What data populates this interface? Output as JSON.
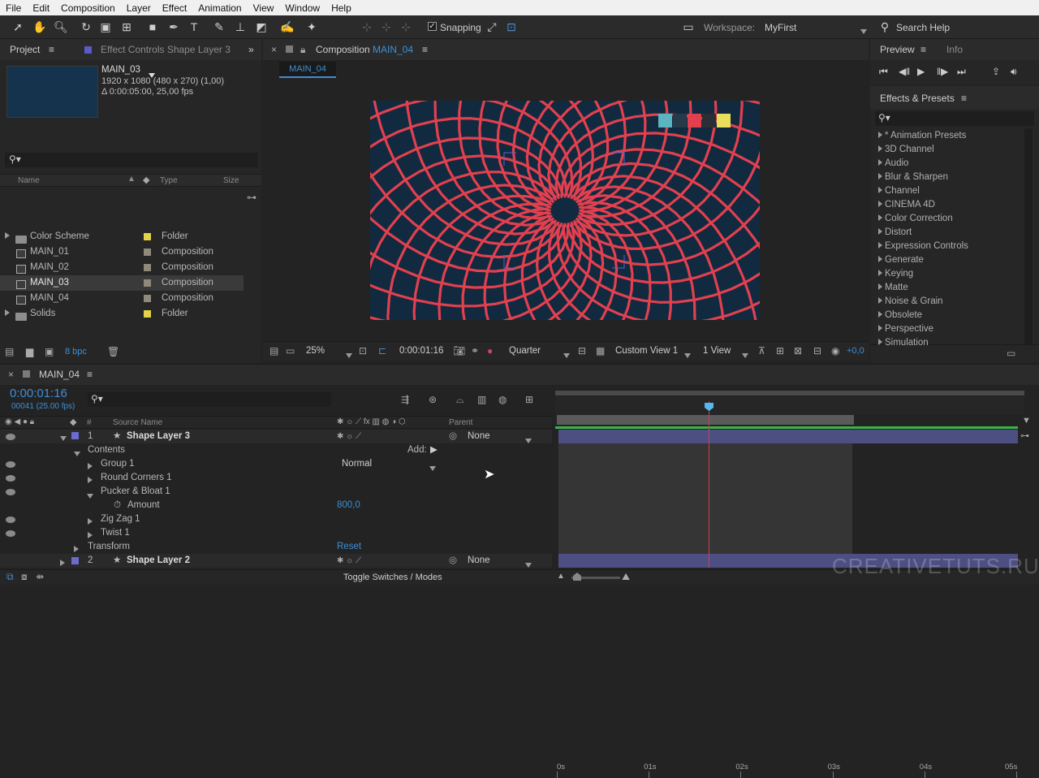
{
  "menu": [
    "File",
    "Edit",
    "Composition",
    "Layer",
    "Effect",
    "Animation",
    "View",
    "Window",
    "Help"
  ],
  "toolbar": {
    "snapping_label": "Snapping",
    "workspace_label": "Workspace:",
    "workspace_value": "MyFirst",
    "search_help": "Search Help"
  },
  "project": {
    "tab_label": "Project",
    "effect_controls_tab": "Effect Controls Shape Layer 3",
    "selected_name": "MAIN_03",
    "selected_info1": "1920 x 1080  (480 x 270) (1,00)",
    "selected_info2": "Δ 0:00:05:00, 25,00 fps",
    "col_name": "Name",
    "col_type": "Type",
    "col_size": "Size",
    "items": [
      {
        "name": "Color Scheme",
        "type": "Folder",
        "color": "#e3d24a",
        "kind": "folder"
      },
      {
        "name": "MAIN_01",
        "type": "Composition",
        "color": "#8f8a7a",
        "kind": "comp"
      },
      {
        "name": "MAIN_02",
        "type": "Composition",
        "color": "#8f8a7a",
        "kind": "comp"
      },
      {
        "name": "MAIN_03",
        "type": "Composition",
        "color": "#8f8a7a",
        "kind": "comp"
      },
      {
        "name": "MAIN_04",
        "type": "Composition",
        "color": "#8f8a7a",
        "kind": "comp"
      },
      {
        "name": "Solids",
        "type": "Folder",
        "color": "#e3d24a",
        "kind": "folder"
      }
    ],
    "bpc": "8 bpc"
  },
  "composition": {
    "tab_prefix": "Composition",
    "tab_name": "MAIN_04",
    "subtab": "MAIN_04",
    "zoom": "25%",
    "timecode": "0:00:01:16",
    "resolution": "Quarter",
    "view": "Custom View 1",
    "views": "1 View",
    "exposure": "+0,0"
  },
  "preview": {
    "tab": "Preview",
    "info_tab": "Info"
  },
  "effects": {
    "tab": "Effects & Presets",
    "items": [
      "* Animation Presets",
      "3D Channel",
      "Audio",
      "Blur & Sharpen",
      "Channel",
      "CINEMA 4D",
      "Color Correction",
      "Distort",
      "Expression Controls",
      "Generate",
      "Keying",
      "Matte",
      "Noise & Grain",
      "Obsolete",
      "Perspective",
      "Simulation"
    ]
  },
  "timeline": {
    "tab": "MAIN_04",
    "timecode": "0:00:01:16",
    "frame_info": "00041 (25.00 fps)",
    "col_source": "Source Name",
    "col_parent": "Parent",
    "layer3": {
      "num": "1",
      "name": "Shape Layer 3",
      "parent": "None"
    },
    "contents": "Contents",
    "add_label": "Add:",
    "group1": "Group 1",
    "blend": "Normal",
    "round_corners": "Round Corners 1",
    "pucker": "Pucker & Bloat 1",
    "amount_label": "Amount",
    "amount_value": "800,0",
    "zigzag": "Zig Zag 1",
    "twist": "Twist 1",
    "transform": "Transform",
    "reset": "Reset",
    "layer2": {
      "num": "2",
      "name": "Shape Layer 2",
      "parent": "None"
    },
    "ticks": [
      "0s",
      "01s",
      "02s",
      "03s",
      "04s",
      "05s"
    ],
    "toggle_label": "Toggle Switches / Modes",
    "watermark": "CREATIVETUTS.RU"
  },
  "colors": {
    "accent": "#3e8fd6",
    "comp_bg": "#112a3f",
    "spiral": "#e2404f",
    "layer_bar": "#4d4f82",
    "playhead": "#d23c55"
  }
}
